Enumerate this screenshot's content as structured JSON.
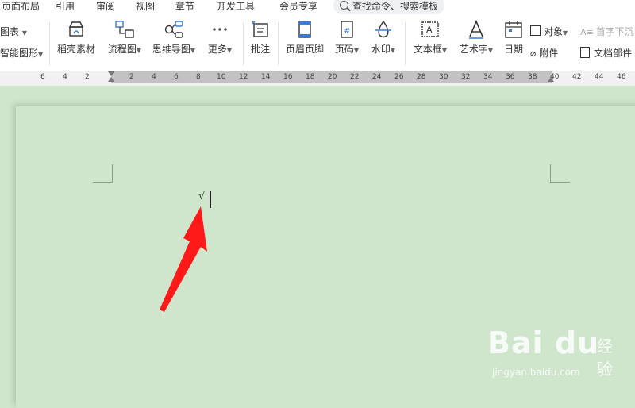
{
  "tabs": [
    "页面布局",
    "引用",
    "审阅",
    "视图",
    "章节",
    "开发工具",
    "会员专享"
  ],
  "search": {
    "placeholder": "查找命令、搜索模板"
  },
  "ribbon": {
    "left_top": "图表",
    "left_bottom": "智能图形",
    "buttons": [
      "稻壳素材",
      "流程图",
      "思维导图",
      "更多",
      "批注",
      "页眉页脚",
      "页码",
      "水印",
      "文本框",
      "艺术字",
      "日期"
    ],
    "right_top": [
      "对象",
      "首字下沉"
    ],
    "right_bottom": [
      "附件",
      "文档部件"
    ]
  },
  "ruler": [
    "6",
    "4",
    "2",
    "2",
    "4",
    "6",
    "8",
    "10",
    "12",
    "14",
    "16",
    "18",
    "20",
    "22",
    "24",
    "26",
    "28",
    "30",
    "32",
    "34",
    "36",
    "38",
    "40",
    "42",
    "44",
    "46"
  ],
  "document": {
    "content": "√"
  },
  "watermark": {
    "logo": "Bai du",
    "brand": "经验",
    "url": "jingyan.baidu.com"
  },
  "colors": {
    "page_bg": "#cfe6cd",
    "arrow": "#ff1a1a"
  }
}
